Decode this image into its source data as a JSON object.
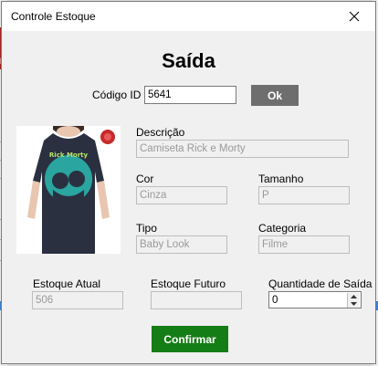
{
  "window": {
    "title": "Controle Estoque"
  },
  "heading": "Saída",
  "codigo": {
    "label": "Código ID",
    "value": "5641"
  },
  "ok_button": "Ok",
  "descricao": {
    "label": "Descrição",
    "value": "Camiseta Rick e Morty"
  },
  "cor": {
    "label": "Cor",
    "value": "Cinza"
  },
  "tamanho": {
    "label": "Tamanho",
    "value": "P"
  },
  "tipo": {
    "label": "Tipo",
    "value": "Baby Look"
  },
  "categoria": {
    "label": "Categoria",
    "value": "Filme"
  },
  "estoque_atual": {
    "label": "Estoque Atual",
    "value": "506"
  },
  "estoque_futuro": {
    "label": "Estoque Futuro",
    "value": ""
  },
  "quantidade_saida": {
    "label": "Quantidade de Saída",
    "value": "0"
  },
  "confirm_button": "Confirmar",
  "background_app": {
    "left_letter": "E"
  },
  "colors": {
    "ok_button": "#6e6e6e",
    "confirm_button": "#157d16",
    "shirt": "#2a3040",
    "print": "#2aa5a0"
  }
}
